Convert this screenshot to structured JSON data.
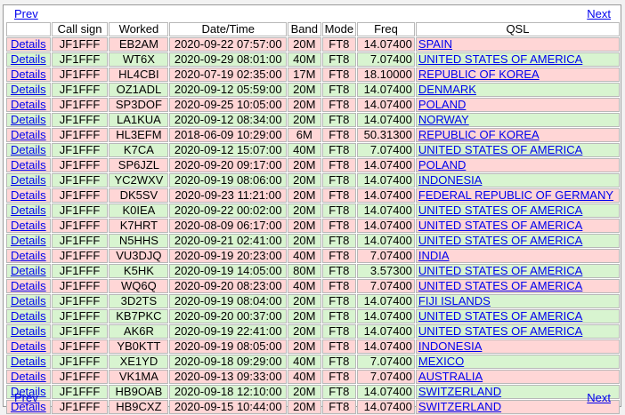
{
  "nav": {
    "prev_label": "Prev",
    "next_label": "Next"
  },
  "headers": [
    "",
    "Call sign",
    "Worked",
    "Date/Time",
    "Band",
    "Mode",
    "Freq",
    "QSL"
  ],
  "details_label": "Details",
  "rows": [
    {
      "call": "JF1FFF",
      "worked": "EB2AM",
      "datetime": "2020-09-22 07:57:00",
      "band": "20M",
      "mode": "FT8",
      "freq": "14.07400",
      "qsl": "SPAIN",
      "status": "pink"
    },
    {
      "call": "JF1FFF",
      "worked": "WT6X",
      "datetime": "2020-09-29 08:01:00",
      "band": "40M",
      "mode": "FT8",
      "freq": "7.07400",
      "qsl": "UNITED STATES OF AMERICA",
      "status": "green"
    },
    {
      "call": "JF1FFF",
      "worked": "HL4CBI",
      "datetime": "2020-07-19 02:35:00",
      "band": "17M",
      "mode": "FT8",
      "freq": "18.10000",
      "qsl": "REPUBLIC OF KOREA",
      "status": "pink"
    },
    {
      "call": "JF1FFF",
      "worked": "OZ1ADL",
      "datetime": "2020-09-12 05:59:00",
      "band": "20M",
      "mode": "FT8",
      "freq": "14.07400",
      "qsl": "DENMARK",
      "status": "green"
    },
    {
      "call": "JF1FFF",
      "worked": "SP3DOF",
      "datetime": "2020-09-25 10:05:00",
      "band": "20M",
      "mode": "FT8",
      "freq": "14.07400",
      "qsl": "POLAND",
      "status": "pink"
    },
    {
      "call": "JF1FFF",
      "worked": "LA1KUA",
      "datetime": "2020-09-12 08:34:00",
      "band": "20M",
      "mode": "FT8",
      "freq": "14.07400",
      "qsl": "NORWAY",
      "status": "green"
    },
    {
      "call": "JF1FFF",
      "worked": "HL3EFM",
      "datetime": "2018-06-09 10:29:00",
      "band": "6M",
      "mode": "FT8",
      "freq": "50.31300",
      "qsl": "REPUBLIC OF KOREA",
      "status": "pink"
    },
    {
      "call": "JF1FFF",
      "worked": "K7CA",
      "datetime": "2020-09-12 15:07:00",
      "band": "40M",
      "mode": "FT8",
      "freq": "7.07400",
      "qsl": "UNITED STATES OF AMERICA",
      "status": "green"
    },
    {
      "call": "JF1FFF",
      "worked": "SP6JZL",
      "datetime": "2020-09-20 09:17:00",
      "band": "20M",
      "mode": "FT8",
      "freq": "14.07400",
      "qsl": "POLAND",
      "status": "pink"
    },
    {
      "call": "JF1FFF",
      "worked": "YC2WXV",
      "datetime": "2020-09-19 08:06:00",
      "band": "20M",
      "mode": "FT8",
      "freq": "14.07400",
      "qsl": "INDONESIA",
      "status": "green"
    },
    {
      "call": "JF1FFF",
      "worked": "DK5SV",
      "datetime": "2020-09-23 11:21:00",
      "band": "20M",
      "mode": "FT8",
      "freq": "14.07400",
      "qsl": "FEDERAL REPUBLIC OF GERMANY",
      "status": "pink"
    },
    {
      "call": "JF1FFF",
      "worked": "K0IEA",
      "datetime": "2020-09-22 00:02:00",
      "band": "20M",
      "mode": "FT8",
      "freq": "14.07400",
      "qsl": "UNITED STATES OF AMERICA",
      "status": "green"
    },
    {
      "call": "JF1FFF",
      "worked": "K7HRT",
      "datetime": "2020-08-09 06:17:00",
      "band": "20M",
      "mode": "FT8",
      "freq": "14.07400",
      "qsl": "UNITED STATES OF AMERICA",
      "status": "pink"
    },
    {
      "call": "JF1FFF",
      "worked": "N5HHS",
      "datetime": "2020-09-21 02:41:00",
      "band": "20M",
      "mode": "FT8",
      "freq": "14.07400",
      "qsl": "UNITED STATES OF AMERICA",
      "status": "green"
    },
    {
      "call": "JF1FFF",
      "worked": "VU3DJQ",
      "datetime": "2020-09-19 20:23:00",
      "band": "40M",
      "mode": "FT8",
      "freq": "7.07400",
      "qsl": "INDIA",
      "status": "pink"
    },
    {
      "call": "JF1FFF",
      "worked": "K5HK",
      "datetime": "2020-09-19 14:05:00",
      "band": "80M",
      "mode": "FT8",
      "freq": "3.57300",
      "qsl": "UNITED STATES OF AMERICA",
      "status": "green"
    },
    {
      "call": "JF1FFF",
      "worked": "WQ6Q",
      "datetime": "2020-09-20 08:23:00",
      "band": "40M",
      "mode": "FT8",
      "freq": "7.07400",
      "qsl": "UNITED STATES OF AMERICA",
      "status": "pink"
    },
    {
      "call": "JF1FFF",
      "worked": "3D2TS",
      "datetime": "2020-09-19 08:04:00",
      "band": "20M",
      "mode": "FT8",
      "freq": "14.07400",
      "qsl": "FIJI ISLANDS",
      "status": "green"
    },
    {
      "call": "JF1FFF",
      "worked": "KB7PKC",
      "datetime": "2020-09-20 00:37:00",
      "band": "20M",
      "mode": "FT8",
      "freq": "14.07400",
      "qsl": "UNITED STATES OF AMERICA",
      "status": "green"
    },
    {
      "call": "JF1FFF",
      "worked": "AK6R",
      "datetime": "2020-09-19 22:41:00",
      "band": "20M",
      "mode": "FT8",
      "freq": "14.07400",
      "qsl": "UNITED STATES OF AMERICA",
      "status": "green"
    },
    {
      "call": "JF1FFF",
      "worked": "YB0KTT",
      "datetime": "2020-09-19 08:05:00",
      "band": "20M",
      "mode": "FT8",
      "freq": "14.07400",
      "qsl": "INDONESIA",
      "status": "pink"
    },
    {
      "call": "JF1FFF",
      "worked": "XE1YD",
      "datetime": "2020-09-18 09:29:00",
      "band": "40M",
      "mode": "FT8",
      "freq": "7.07400",
      "qsl": "MEXICO",
      "status": "green"
    },
    {
      "call": "JF1FFF",
      "worked": "VK1MA",
      "datetime": "2020-09-13 09:33:00",
      "band": "40M",
      "mode": "FT8",
      "freq": "7.07400",
      "qsl": "AUSTRALIA",
      "status": "pink"
    },
    {
      "call": "JF1FFF",
      "worked": "HB9OAB",
      "datetime": "2020-09-18 12:10:00",
      "band": "20M",
      "mode": "FT8",
      "freq": "14.07400",
      "qsl": "SWITZERLAND",
      "status": "green"
    },
    {
      "call": "JF1FFF",
      "worked": "HB9CXZ",
      "datetime": "2020-09-15 10:44:00",
      "band": "20M",
      "mode": "FT8",
      "freq": "14.07400",
      "qsl": "SWITZERLAND",
      "status": "pink"
    }
  ],
  "colors": {
    "pink_row": "#ffd6d6",
    "green_row": "#d8f4d0",
    "link": "#0000ee"
  }
}
